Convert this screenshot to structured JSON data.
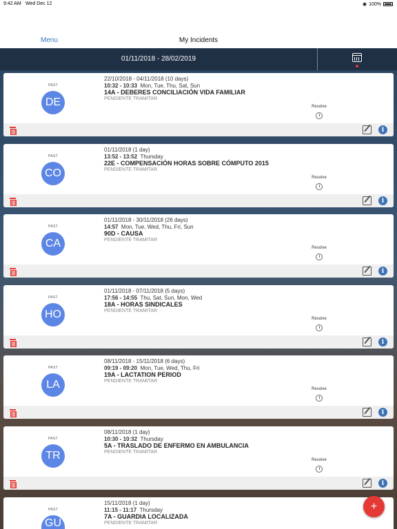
{
  "status_bar": {
    "time": "9:42 AM",
    "date": "Wed Dec 12",
    "battery": "100%"
  },
  "nav": {
    "menu_label": "Menu",
    "title": "My Incidents"
  },
  "range": {
    "label": "01/11/2018 - 28/02/2019"
  },
  "incidents": [
    {
      "past": "PAST",
      "initials": "DE",
      "dates": "22/10/2018 - 04/11/2018 (10 days)",
      "time": "10:32 - 10:33",
      "days": "Mon, Tue, Thu, Sat, Sun",
      "code": "14A - DEBERES CONCILIACIÓN VIDA FAMILIAR",
      "status": "PENDIENTE TRAMITAR",
      "resolve": "Resolve"
    },
    {
      "past": "PAST",
      "initials": "CO",
      "dates": "01/11/2018 (1 day)",
      "time": "13:52 - 13:52",
      "days": "Thursday",
      "code": "22E - COMPENSACIÓN HORAS SOBRE CÓMPUTO 2015",
      "status": "PENDIENTE TRAMITAR",
      "resolve": "Resolve"
    },
    {
      "past": "PAST",
      "initials": "CA",
      "dates": "01/11/2018 - 30/11/2018 (26 days)",
      "time": "14:57",
      "days": "Mon, Tue, Wed, Thu, Fri, Sun",
      "code": "90D - CAUSA",
      "status": "PENDIENTE TRAMITAR",
      "resolve": "Resolve"
    },
    {
      "past": "PAST",
      "initials": "HO",
      "dates": "01/11/2018 - 07/11/2018 (5 days)",
      "time": "17:56 - 14:55",
      "days": "Thu, Sat, Sun, Mon, Wed",
      "code": "18A - HORAS SINDICALES",
      "status": "PENDIENTE TRAMITAR",
      "resolve": "Resolve"
    },
    {
      "past": "PAST",
      "initials": "LA",
      "dates": "08/11/2018 - 15/11/2018 (6 days)",
      "time": "09:19 - 09:20",
      "days": "Mon, Tue, Wed, Thu, Fri",
      "code": "19A - LACTATION PERIOD",
      "status": "PENDIENTE TRAMITAR",
      "resolve": "Resolve"
    },
    {
      "past": "PAST",
      "initials": "TR",
      "dates": "08/11/2018 (1 day)",
      "time": "10:30 - 10:32",
      "days": "Thursday",
      "code": "5A - TRASLADO DE ENFERMO EN AMBULANCIA",
      "status": "PENDIENTE TRAMITAR",
      "resolve": "Resolve"
    },
    {
      "past": "PAST",
      "initials": "GU",
      "dates": "15/11/2018 (1 day)",
      "time": "11:15 - 11:17",
      "days": "Thursday",
      "code": "7A - GUARDIA LOCALIZADA",
      "status": "PENDIENTE TRAMITAR",
      "resolve": ""
    }
  ],
  "fab": {
    "label": "+"
  },
  "colors": {
    "accent": "#3a77c2",
    "avatar": "#5b86e5",
    "danger": "#e53935",
    "header": "#1f2f44"
  }
}
